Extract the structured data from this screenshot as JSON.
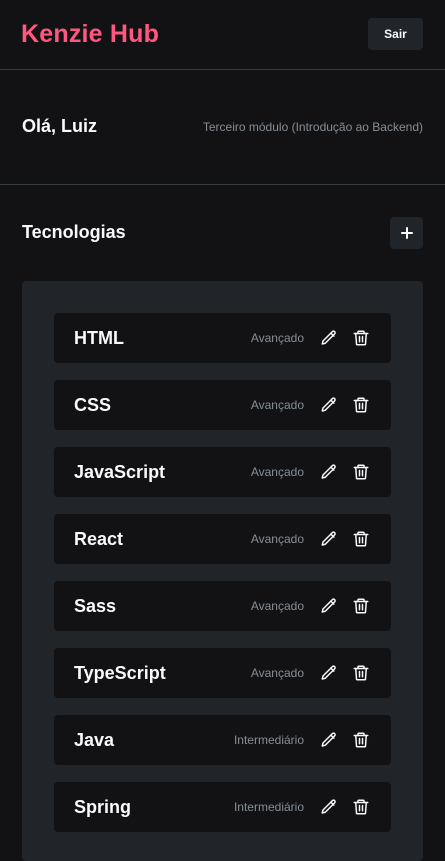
{
  "header": {
    "brand": "Kenzie Hub",
    "logout_label": "Sair"
  },
  "user": {
    "greeting": "Olá, Luiz",
    "module": "Terceiro módulo (Introdução ao Backend)"
  },
  "technologies": {
    "title": "Tecnologias",
    "add_icon": "plus-icon",
    "items": [
      {
        "name": "HTML",
        "status": "Avançado"
      },
      {
        "name": "CSS",
        "status": "Avançado"
      },
      {
        "name": "JavaScript",
        "status": "Avançado"
      },
      {
        "name": "React",
        "status": "Avançado"
      },
      {
        "name": "Sass",
        "status": "Avançado"
      },
      {
        "name": "TypeScript",
        "status": "Avançado"
      },
      {
        "name": "Java",
        "status": "Intermediário"
      },
      {
        "name": "Spring",
        "status": "Intermediário"
      }
    ]
  },
  "colors": {
    "brand": "#ff577f",
    "background": "#121214",
    "surface": "#212529",
    "muted_text": "#868e96"
  }
}
